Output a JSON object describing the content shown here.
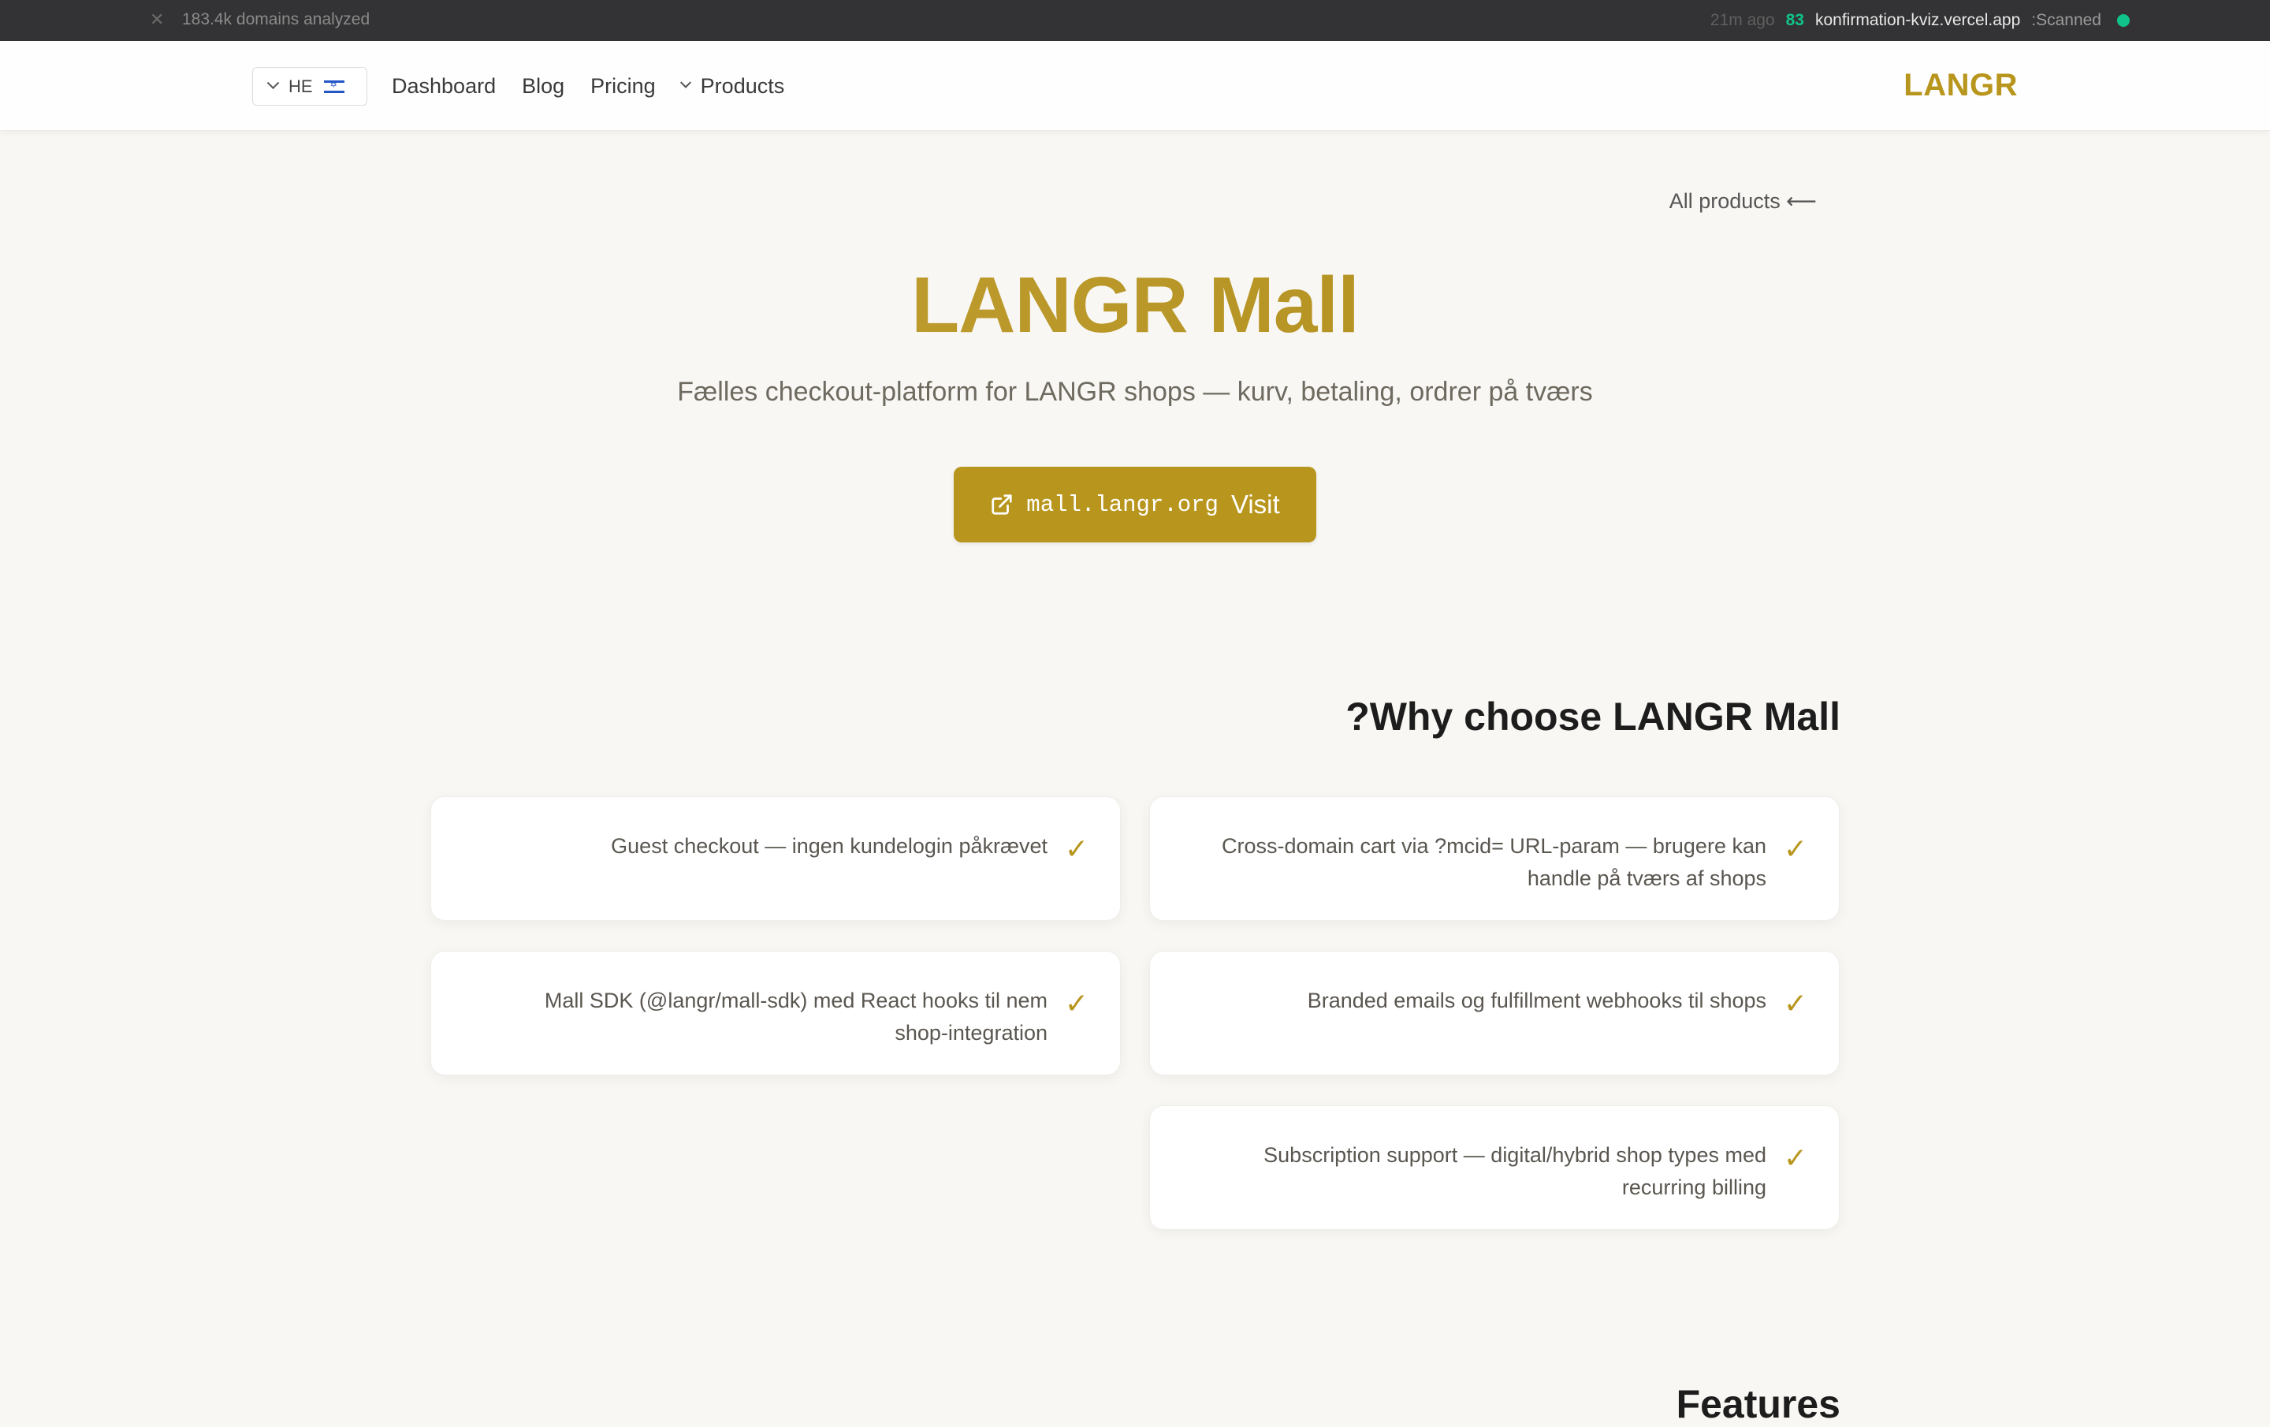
{
  "scanner": {
    "count": "183.4k domains analyzed",
    "time_ago": "21m ago",
    "score": "83",
    "domain": "konfirmation-kviz.vercel.app",
    "status": ":Scanned"
  },
  "header": {
    "language": "HE",
    "nav": [
      "Dashboard",
      "Blog",
      "Pricing"
    ],
    "products_label": "Products",
    "logo": "LANGR"
  },
  "hero": {
    "back_link": "All products ⟵",
    "title": "LANGR Mall",
    "subtitle": "Fælles checkout-platform for LANGR shops — kurv, betaling, ordrer på tværs",
    "visit_url": "mall.langr.org",
    "visit_label": "Visit"
  },
  "why": {
    "title": "?Why choose LANGR Mall",
    "items": [
      "Guest checkout — ingen kundelogin påkrævet",
      "Cross-domain cart via ?mcid= URL-param — brugere kan handle på tværs af shops",
      "Mall SDK (@langr/mall-sdk) med React hooks til nem shop-integration",
      "Branded emails og fulfillment webhooks til shops",
      "Subscription support — digital/hybrid shop types med recurring billing"
    ],
    "check": "✓"
  },
  "features": {
    "title": "Features"
  },
  "colors": {
    "accent": "#b8961d",
    "scan_green": "#10c38a",
    "background": "#f8f7f3"
  }
}
